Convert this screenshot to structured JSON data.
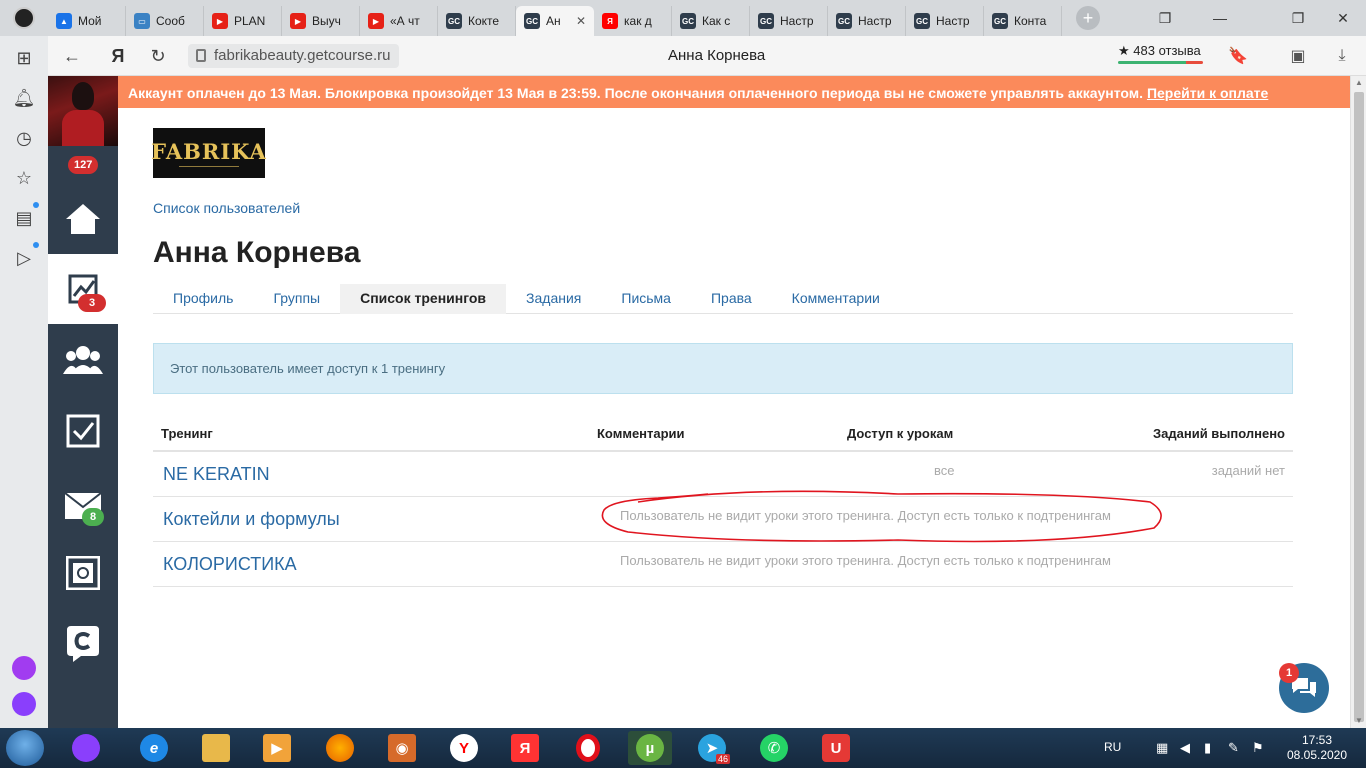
{
  "browser": {
    "tabs": [
      {
        "title": "Мой",
        "fav_color": "#1a73e8",
        "fav_text": "▲"
      },
      {
        "title": "Сооб",
        "fav_color": "#3b82c4",
        "fav_text": "▭"
      },
      {
        "title": "PLAN",
        "fav_color": "#e62117",
        "fav_text": "▶"
      },
      {
        "title": "Выуч",
        "fav_color": "#e62117",
        "fav_text": "▶"
      },
      {
        "title": "«А чт",
        "fav_color": "#e62117",
        "fav_text": "▶"
      },
      {
        "title": "Кокте",
        "fav_color": "#2f3d4c",
        "fav_text": "GC"
      },
      {
        "title": "Ан",
        "fav_color": "#2f3d4c",
        "fav_text": "GC",
        "active": true
      },
      {
        "title": "как д",
        "fav_color": "#ff0000",
        "fav_text": "Я"
      },
      {
        "title": "Как с",
        "fav_color": "#2f3d4c",
        "fav_text": "GC"
      },
      {
        "title": "Настр",
        "fav_color": "#2f3d4c",
        "fav_text": "GC"
      },
      {
        "title": "Настр",
        "fav_color": "#2f3d4c",
        "fav_text": "GC"
      },
      {
        "title": "Настр",
        "fav_color": "#2f3d4c",
        "fav_text": "GC"
      },
      {
        "title": "Конта",
        "fav_color": "#2f3d4c",
        "fav_text": "GC"
      }
    ],
    "url": "fabrikabeauty.getcourse.ru",
    "page_title": "Анна Корнева",
    "reviews": "★ 483 отзыва",
    "yandex_logo": "Я"
  },
  "gc_sidebar": {
    "notifications_badge": "127",
    "stats_badge": "3",
    "messages_badge": "8"
  },
  "notice": {
    "text": "Аккаунт оплачен до 13 Мая. Блокировка произойдет 13 Мая в 23:59. После окончания оплаченного периода вы не сможете управлять аккаунтом.",
    "link": "Перейти к оплате"
  },
  "page": {
    "logo_text": "FABRIKA",
    "breadcrumb": "Список пользователей",
    "user_name": "Анна Корнева",
    "tabs": [
      {
        "label": "Профиль"
      },
      {
        "label": "Группы"
      },
      {
        "label": "Список тренингов",
        "active": true
      },
      {
        "label": "Задания"
      },
      {
        "label": "Письма"
      },
      {
        "label": "Права"
      },
      {
        "label": "Комментарии"
      }
    ],
    "info_text": "Этот пользователь имеет доступ к 1 тренингу",
    "table": {
      "headers": [
        "Тренинг",
        "Комментарии",
        "Доступ к урокам",
        "Заданий выполнено"
      ],
      "rows": [
        {
          "name": "NE KERATIN",
          "access": "все",
          "tasks": "заданий нет",
          "note": ""
        },
        {
          "name": "Коктейли и формулы",
          "access": "",
          "tasks": "",
          "note": "Пользователь не видит уроки этого тренинга. Доступ есть только к подтренингам"
        },
        {
          "name": "КОЛОРИСТИКА",
          "access": "",
          "tasks": "",
          "note": "Пользователь не видит уроки этого тренинга. Доступ есть только к подтренингам"
        }
      ]
    }
  },
  "chat": {
    "badge": "1"
  },
  "taskbar": {
    "lang": "RU",
    "time": "17:53",
    "date": "08.05.2020",
    "telegram_badge": "46"
  }
}
